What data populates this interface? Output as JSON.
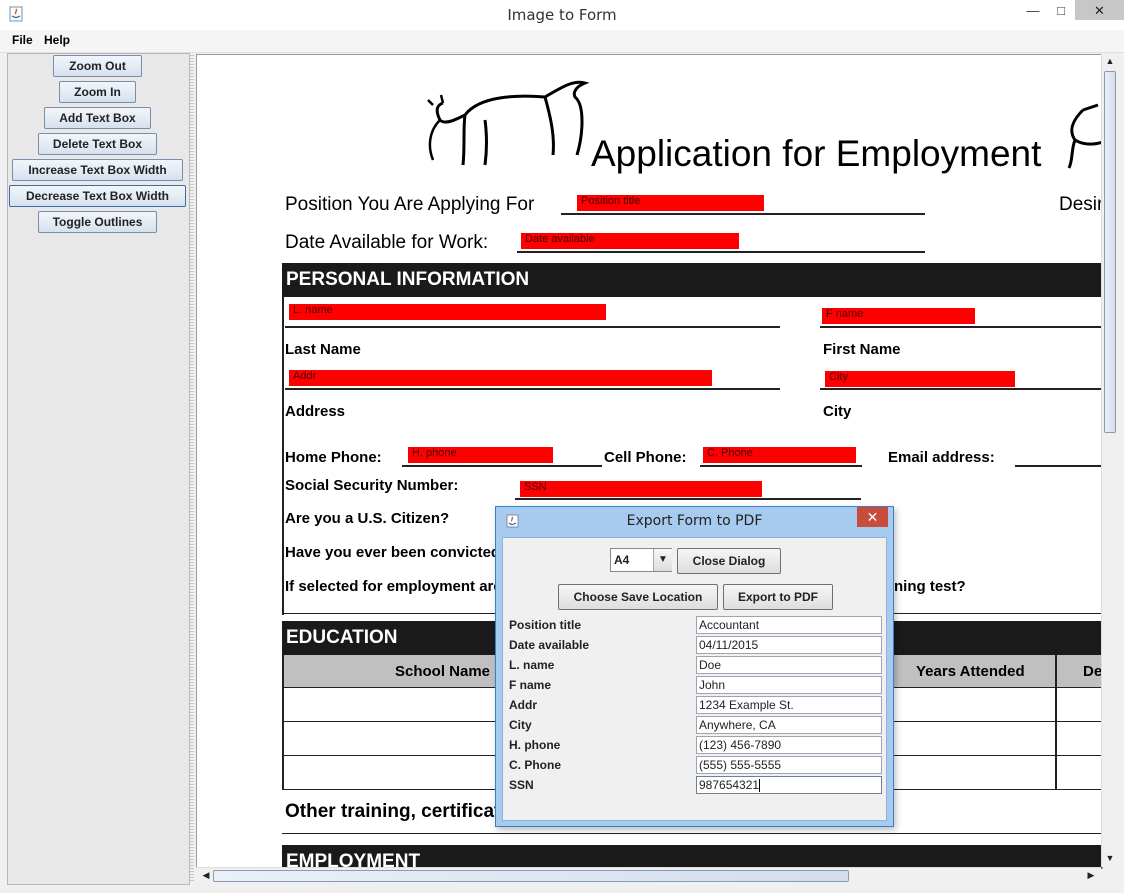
{
  "window": {
    "title": "Image to Form",
    "minimize": "—",
    "maximize": "□",
    "close": "✕"
  },
  "menu": [
    "File",
    "Help"
  ],
  "sidebar": {
    "buttons": [
      "Zoom Out",
      "Zoom In",
      "Add Text Box",
      "Delete Text Box",
      "Increase Text Box Width",
      "Decrease Text Box Width",
      "Toggle Outlines"
    ]
  },
  "document": {
    "heading": "Application for Employment",
    "position_label": "Position You Are Applying For",
    "date_label": "Date Available for Work:",
    "desired_fragment": "Desir",
    "personal_band": "PERSONAL INFORMATION",
    "last_name": "Last Name",
    "first_name": "First Name",
    "address": "Address",
    "city": "City",
    "home_phone": "Home Phone:",
    "cell_phone": "Cell Phone:",
    "email": "Email address:",
    "ssn": "Social Security Number:",
    "citizen": "Are you a U.S. Citizen?",
    "convicted": "Have you ever been convicted",
    "selected": "If selected for employment are",
    "selected_tail": "ning test?",
    "education_band": "EDUCATION",
    "school_name": "School Name",
    "years_attended": "Years Attended",
    "degree_fragment": "De",
    "other_training": "Other training, certificat",
    "employment_band": "EMPLOYMENT"
  },
  "text_boxes": [
    "Position title",
    "Date available",
    "L. name",
    "F name",
    "Addr",
    "City",
    "H. phone",
    "C. Phone",
    "SSN"
  ],
  "dialog": {
    "title": "Export Form to PDF",
    "close": "✕",
    "page_size": "A4",
    "close_dialog": "Close Dialog",
    "choose_save": "Choose Save Location",
    "export": "Export to PDF",
    "fields": [
      {
        "label": "Position title",
        "value": "Accountant"
      },
      {
        "label": "Date available",
        "value": "04/11/2015"
      },
      {
        "label": "L. name",
        "value": "Doe"
      },
      {
        "label": "F name",
        "value": "John"
      },
      {
        "label": "Addr",
        "value": "1234 Example St."
      },
      {
        "label": "City",
        "value": "Anywhere, CA"
      },
      {
        "label": "H. phone",
        "value": "(123) 456-7890"
      },
      {
        "label": "C. Phone",
        "value": "(555) 555-5555"
      },
      {
        "label": "SSN",
        "value": "987654321"
      }
    ]
  }
}
